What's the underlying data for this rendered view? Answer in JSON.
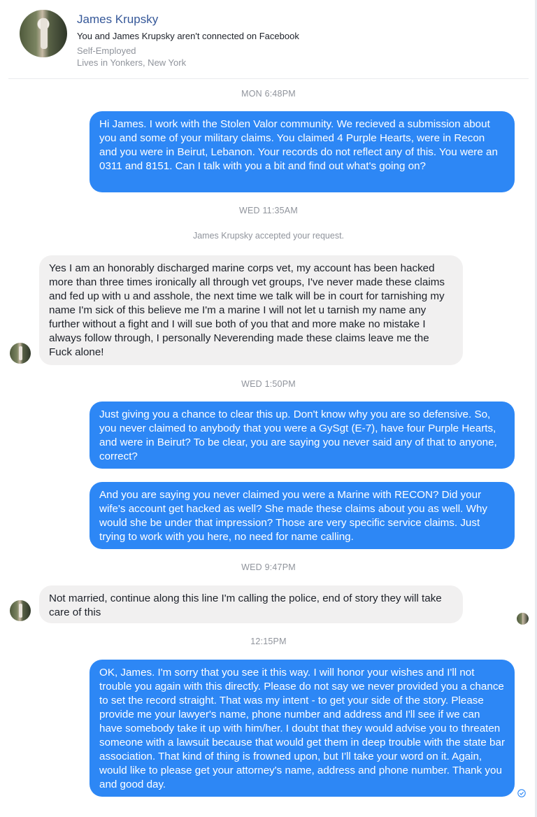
{
  "header": {
    "name": "James Krupsky",
    "connection_note": "You and James Krupsky aren't connected on Facebook",
    "work": "Self-Employed",
    "lives": "Lives in Yonkers, New York"
  },
  "messages": [
    {
      "type": "timestamp",
      "text": "MON 6:48PM"
    },
    {
      "type": "outgoing",
      "text": "Hi James.  I work with the Stolen Valor community.  We recieved a submission about you and some of your military claims.  You claimed 4 Purple Hearts, were in Recon and you were in Beirut, Lebanon.  Your records do not reflect any of this.  You were an 0311 and 8151.  Can I talk with you a bit and find out what's going on?"
    },
    {
      "type": "timestamp",
      "text": "WED 11:35AM"
    },
    {
      "type": "system",
      "text": "James Krupsky accepted your request."
    },
    {
      "type": "incoming",
      "text": "Yes I am an honorably discharged marine corps vet, my account has been hacked more than three times ironically all through vet groups, I've never made these claims and fed up with u and asshole, the next time we talk will be in court for tarnishing my name I'm sick of this believe me I'm a marine I will not let u tarnish my name any further without a fight and I will sue both of you that and more make no mistake I always follow through, I personally Neverending made these claims leave me the Fuck alone!"
    },
    {
      "type": "timestamp",
      "text": "WED 1:50PM"
    },
    {
      "type": "outgoing",
      "text": "Just giving you a chance to clear this up.  Don't know why you are so defensive.  So, you never claimed to anybody that you were a GySgt (E-7), have four Purple Hearts, and were in Beirut?  To be clear, you are saying you never said any of that to anyone, correct?"
    },
    {
      "type": "outgoing",
      "text": "And you are saying you never claimed you were a Marine with RECON?  Did your wife's account get hacked as well?  She made these claims about you as well.  Why would she be under that impression?  Those are very specific service claims.  Just trying to work with you here, no need for name calling."
    },
    {
      "type": "timestamp",
      "text": "WED 9:47PM"
    },
    {
      "type": "incoming",
      "text": "Not married, continue along this line I'm calling the police, end of story they will take care of this"
    },
    {
      "type": "timestamp",
      "text": "12:15PM"
    },
    {
      "type": "outgoing",
      "text": "OK, James.  I'm sorry that you see it this way.  I will honor your wishes and I'll not trouble you again with this directly.  Please do not say we never provided you a chance to set the record straight.  That was my intent - to get your side of the story.  Please provide me your lawyer's name, phone number and address and I'll see if we can have somebody take it up with him/her.  I doubt that they would advise you to threaten someone with a lawsuit because that would get them in deep trouble with the state bar association. That kind of thing is frowned upon, but I'll take your word on it.  Again, would like to please get your attorney's name, address and phone number.  Thank you and good day."
    }
  ],
  "icons": {
    "avatar": "profile-photo",
    "seen": "check-circle-icon",
    "read_receipt": "profile-photo"
  },
  "colors": {
    "outgoing_bubble": "#2d87f5",
    "incoming_bubble": "#f1f0f0",
    "name_link": "#365899",
    "muted_text": "#90949c"
  }
}
